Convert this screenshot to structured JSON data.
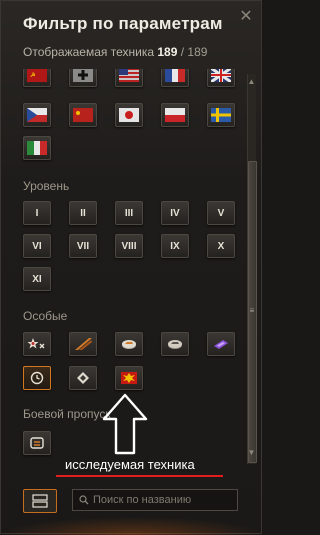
{
  "header": {
    "title": "Фильтр по параметрам",
    "close_icon": "close-icon"
  },
  "summary": {
    "label": "Отображаемая техника",
    "count": "189",
    "separator": " / ",
    "total": "189"
  },
  "nations": [
    "ussr",
    "germany",
    "usa",
    "france",
    "uk",
    "czechoslovakia",
    "china",
    "japan",
    "poland",
    "sweden",
    "italy"
  ],
  "level": {
    "label": "Уровень",
    "tiers": [
      "I",
      "II",
      "III",
      "IV",
      "V",
      "VI",
      "VII",
      "VIII",
      "IX",
      "X",
      "XI"
    ]
  },
  "special": {
    "label": "Особые",
    "items": [
      "elite-star-icon",
      "premium-stripe-icon",
      "tank-coin-icon",
      "tank-coin-alt-icon",
      "rental-ticket-icon",
      "timer-icon",
      "diamond-icon",
      "explosion-icon"
    ]
  },
  "battle_pass": {
    "label": "Боевой пропуск",
    "items": [
      "battle-pass-icon"
    ]
  },
  "annotation": {
    "text": "исследуемая техника",
    "accent_color": "#e21d1d"
  },
  "search": {
    "placeholder": "Поиск по названию",
    "value": ""
  },
  "colors": {
    "accent": "#d4781f"
  }
}
